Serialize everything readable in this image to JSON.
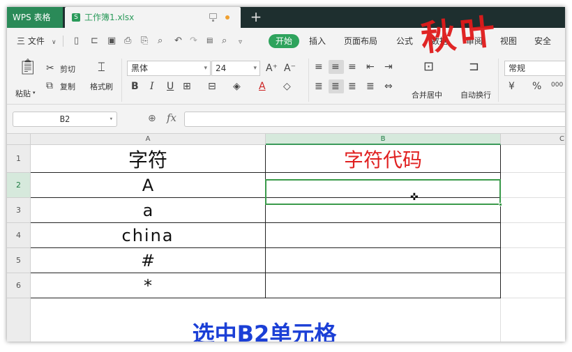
{
  "titlebar": {
    "app_name": "WPS 表格",
    "doc_tab": "工作簿1.xlsx",
    "new_tab": "+"
  },
  "menu": {
    "file": "三 文件",
    "items": [
      "开始",
      "插入",
      "页面布局",
      "公式",
      "数据",
      "审阅",
      "视图",
      "安全"
    ]
  },
  "watermark": "秋叶",
  "ribbon": {
    "paste": "粘贴",
    "cut": "剪切",
    "copy": "复制",
    "format_painter": "格式刷",
    "font_name": "黑体",
    "font_size": "24",
    "grow_font": "A⁺",
    "shrink_font": "A⁻",
    "bold": "B",
    "italic": "I",
    "underline": "U",
    "merge_center": "合并居中",
    "wrap_text": "自动换行",
    "number_format": "常规",
    "percent": "%"
  },
  "formula_bar": {
    "name_box": "B2",
    "fx": "fx",
    "formula": ""
  },
  "sheet": {
    "col_headers": [
      "A",
      "B",
      "C"
    ],
    "row_headers": [
      "1",
      "2",
      "3",
      "4",
      "5",
      "6"
    ],
    "column_a": [
      "字符",
      "A",
      "a",
      "china",
      "#",
      "*"
    ],
    "column_b": [
      "字符代码",
      "",
      "",
      "",
      "",
      ""
    ],
    "selected_cell": "B2"
  },
  "caption": "选中B2单元格",
  "colors": {
    "app_green": "#2a8a58",
    "selection_green": "#3a9a4a",
    "header_red": "#e02020",
    "caption_blue": "#1b3fd6"
  }
}
